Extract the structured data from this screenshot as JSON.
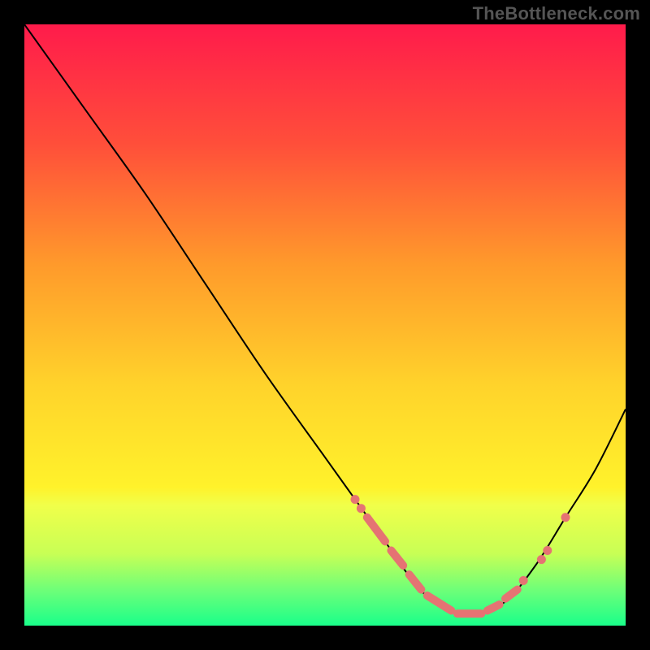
{
  "watermark": "TheBottleneck.com",
  "chart_data": {
    "type": "line",
    "title": "",
    "xlabel": "",
    "ylabel": "",
    "xlim": [
      0,
      100
    ],
    "ylim": [
      0,
      100
    ],
    "grid": false,
    "series": [
      {
        "name": "curve",
        "x": [
          0,
          10,
          20,
          30,
          40,
          50,
          55,
          60,
          62,
          65,
          68,
          72,
          75,
          80,
          85,
          90,
          95,
          100
        ],
        "y": [
          100,
          86,
          72,
          57,
          42,
          28,
          21,
          14,
          11,
          7,
          4,
          2,
          2,
          4,
          10,
          18,
          26,
          36
        ]
      }
    ],
    "markers": {
      "dots": [
        {
          "x": 55,
          "y": 21
        },
        {
          "x": 56,
          "y": 19.5
        },
        {
          "x": 83,
          "y": 7.5
        },
        {
          "x": 86,
          "y": 11
        },
        {
          "x": 87,
          "y": 12.5
        },
        {
          "x": 90,
          "y": 18
        }
      ],
      "dashes": [
        {
          "x1": 57,
          "y1": 18,
          "x2": 60,
          "y2": 14
        },
        {
          "x1": 61,
          "y1": 12.5,
          "x2": 63,
          "y2": 10
        },
        {
          "x1": 64,
          "y1": 8.5,
          "x2": 66,
          "y2": 6
        },
        {
          "x1": 67,
          "y1": 5,
          "x2": 71,
          "y2": 2.5
        },
        {
          "x1": 72,
          "y1": 2,
          "x2": 76,
          "y2": 2
        },
        {
          "x1": 77,
          "y1": 2.5,
          "x2": 79,
          "y2": 3.5
        },
        {
          "x1": 80,
          "y1": 4.5,
          "x2": 82,
          "y2": 6
        }
      ]
    },
    "gradient_stops": [
      {
        "offset": 0.0,
        "color": "#ff1b4b"
      },
      {
        "offset": 0.2,
        "color": "#ff4f3a"
      },
      {
        "offset": 0.4,
        "color": "#ff9a2b"
      },
      {
        "offset": 0.6,
        "color": "#ffd32b"
      },
      {
        "offset": 0.77,
        "color": "#fff22b"
      },
      {
        "offset": 0.8,
        "color": "#f0ff4a"
      },
      {
        "offset": 0.88,
        "color": "#c8ff55"
      },
      {
        "offset": 0.94,
        "color": "#6fff78"
      },
      {
        "offset": 1.0,
        "color": "#1aff8a"
      }
    ]
  }
}
